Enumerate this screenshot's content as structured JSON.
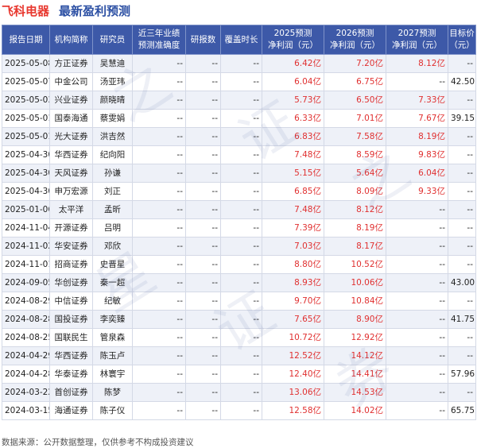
{
  "title": {
    "company": "飞科电器",
    "subtitle": "最新盈利预测"
  },
  "headers": [
    "报告日期",
    "机构简称",
    "研究员",
    "近三年业绩\n预测准确度",
    "研报数",
    "覆盖时长",
    "2025预测\n净利润（元）",
    "2026预测\n净利润（元）",
    "2027预测\n净利润（元）",
    "目标价\n（元）"
  ],
  "rows": [
    {
      "date": "2025-05-08",
      "org": "方正证券",
      "analyst": "吴慧迪",
      "acc": "--",
      "reports": "--",
      "duration": "--",
      "p2025": "6.42亿",
      "p2026": "7.20亿",
      "p2027": "8.12亿",
      "target": "--"
    },
    {
      "date": "2025-05-07",
      "org": "中金公司",
      "analyst": "汤亚玮",
      "acc": "--",
      "reports": "--",
      "duration": "--",
      "p2025": "6.04亿",
      "p2026": "6.75亿",
      "p2027": "--",
      "target": "42.50"
    },
    {
      "date": "2025-05-03",
      "org": "兴业证券",
      "analyst": "颜晓晴",
      "acc": "--",
      "reports": "--",
      "duration": "--",
      "p2025": "5.73亿",
      "p2026": "6.50亿",
      "p2027": "7.33亿",
      "target": "--"
    },
    {
      "date": "2025-05-01",
      "org": "国泰海通",
      "analyst": "蔡雯娟",
      "acc": "--",
      "reports": "--",
      "duration": "--",
      "p2025": "6.33亿",
      "p2026": "7.01亿",
      "p2027": "7.67亿",
      "target": "39.15"
    },
    {
      "date": "2025-05-01",
      "org": "光大证券",
      "analyst": "洪吉然",
      "acc": "--",
      "reports": "--",
      "duration": "--",
      "p2025": "6.83亿",
      "p2026": "7.58亿",
      "p2027": "8.19亿",
      "target": "--"
    },
    {
      "date": "2025-04-30",
      "org": "华西证券",
      "analyst": "纪向阳",
      "acc": "--",
      "reports": "--",
      "duration": "--",
      "p2025": "7.48亿",
      "p2026": "8.59亿",
      "p2027": "9.83亿",
      "target": "--"
    },
    {
      "date": "2025-04-30",
      "org": "天风证券",
      "analyst": "孙谦",
      "acc": "--",
      "reports": "--",
      "duration": "--",
      "p2025": "5.15亿",
      "p2026": "5.64亿",
      "p2027": "6.04亿",
      "target": "--"
    },
    {
      "date": "2025-04-30",
      "org": "申万宏源",
      "analyst": "刘正",
      "acc": "--",
      "reports": "--",
      "duration": "--",
      "p2025": "6.85亿",
      "p2026": "8.09亿",
      "p2027": "9.33亿",
      "target": "--"
    },
    {
      "date": "2025-01-06",
      "org": "太平洋",
      "analyst": "孟昕",
      "acc": "--",
      "reports": "--",
      "duration": "--",
      "p2025": "7.48亿",
      "p2026": "8.12亿",
      "p2027": "--",
      "target": "--"
    },
    {
      "date": "2024-11-04",
      "org": "开源证券",
      "analyst": "吕明",
      "acc": "--",
      "reports": "--",
      "duration": "--",
      "p2025": "7.39亿",
      "p2026": "8.19亿",
      "p2027": "--",
      "target": "--"
    },
    {
      "date": "2024-11-02",
      "org": "华安证券",
      "analyst": "邓欣",
      "acc": "--",
      "reports": "--",
      "duration": "--",
      "p2025": "7.03亿",
      "p2026": "8.17亿",
      "p2027": "--",
      "target": "--"
    },
    {
      "date": "2024-11-01",
      "org": "招商证券",
      "analyst": "史晋星",
      "acc": "--",
      "reports": "--",
      "duration": "--",
      "p2025": "8.80亿",
      "p2026": "10.52亿",
      "p2027": "--",
      "target": "--"
    },
    {
      "date": "2024-09-05",
      "org": "华创证券",
      "analyst": "秦一超",
      "acc": "--",
      "reports": "--",
      "duration": "--",
      "p2025": "8.93亿",
      "p2026": "10.06亿",
      "p2027": "--",
      "target": "43.00"
    },
    {
      "date": "2024-08-29",
      "org": "中信证券",
      "analyst": "纪敏",
      "acc": "--",
      "reports": "--",
      "duration": "--",
      "p2025": "9.70亿",
      "p2026": "10.84亿",
      "p2027": "--",
      "target": "--"
    },
    {
      "date": "2024-08-28",
      "org": "国投证券",
      "analyst": "李奕臻",
      "acc": "--",
      "reports": "--",
      "duration": "--",
      "p2025": "7.65亿",
      "p2026": "8.90亿",
      "p2027": "--",
      "target": "41.75"
    },
    {
      "date": "2024-08-25",
      "org": "国联民生",
      "analyst": "管泉森",
      "acc": "--",
      "reports": "--",
      "duration": "--",
      "p2025": "10.72亿",
      "p2026": "12.92亿",
      "p2027": "--",
      "target": "--"
    },
    {
      "date": "2024-04-29",
      "org": "华西证券",
      "analyst": "陈玉卢",
      "acc": "--",
      "reports": "--",
      "duration": "--",
      "p2025": "12.52亿",
      "p2026": "14.12亿",
      "p2027": "--",
      "target": "--"
    },
    {
      "date": "2024-04-28",
      "org": "华泰证券",
      "analyst": "林寰宇",
      "acc": "--",
      "reports": "--",
      "duration": "--",
      "p2025": "12.40亿",
      "p2026": "14.41亿",
      "p2027": "--",
      "target": "57.96"
    },
    {
      "date": "2024-03-22",
      "org": "首创证券",
      "analyst": "陈梦",
      "acc": "--",
      "reports": "--",
      "duration": "--",
      "p2025": "13.06亿",
      "p2026": "14.53亿",
      "p2027": "--",
      "target": "--"
    },
    {
      "date": "2024-03-15",
      "org": "海通证券",
      "analyst": "陈子仪",
      "acc": "--",
      "reports": "--",
      "duration": "--",
      "p2025": "12.58亿",
      "p2026": "14.02亿",
      "p2027": "--",
      "target": "65.75"
    }
  ],
  "footer": "数据来源：公开数据整理，仅供参考不构成投资建议",
  "colors": {
    "header_bg": "#3d59a8",
    "title_red": "#e8382f",
    "title_blue": "#2b4fa3",
    "value_red": "#e03030",
    "row_alt": "#eef1f8"
  }
}
